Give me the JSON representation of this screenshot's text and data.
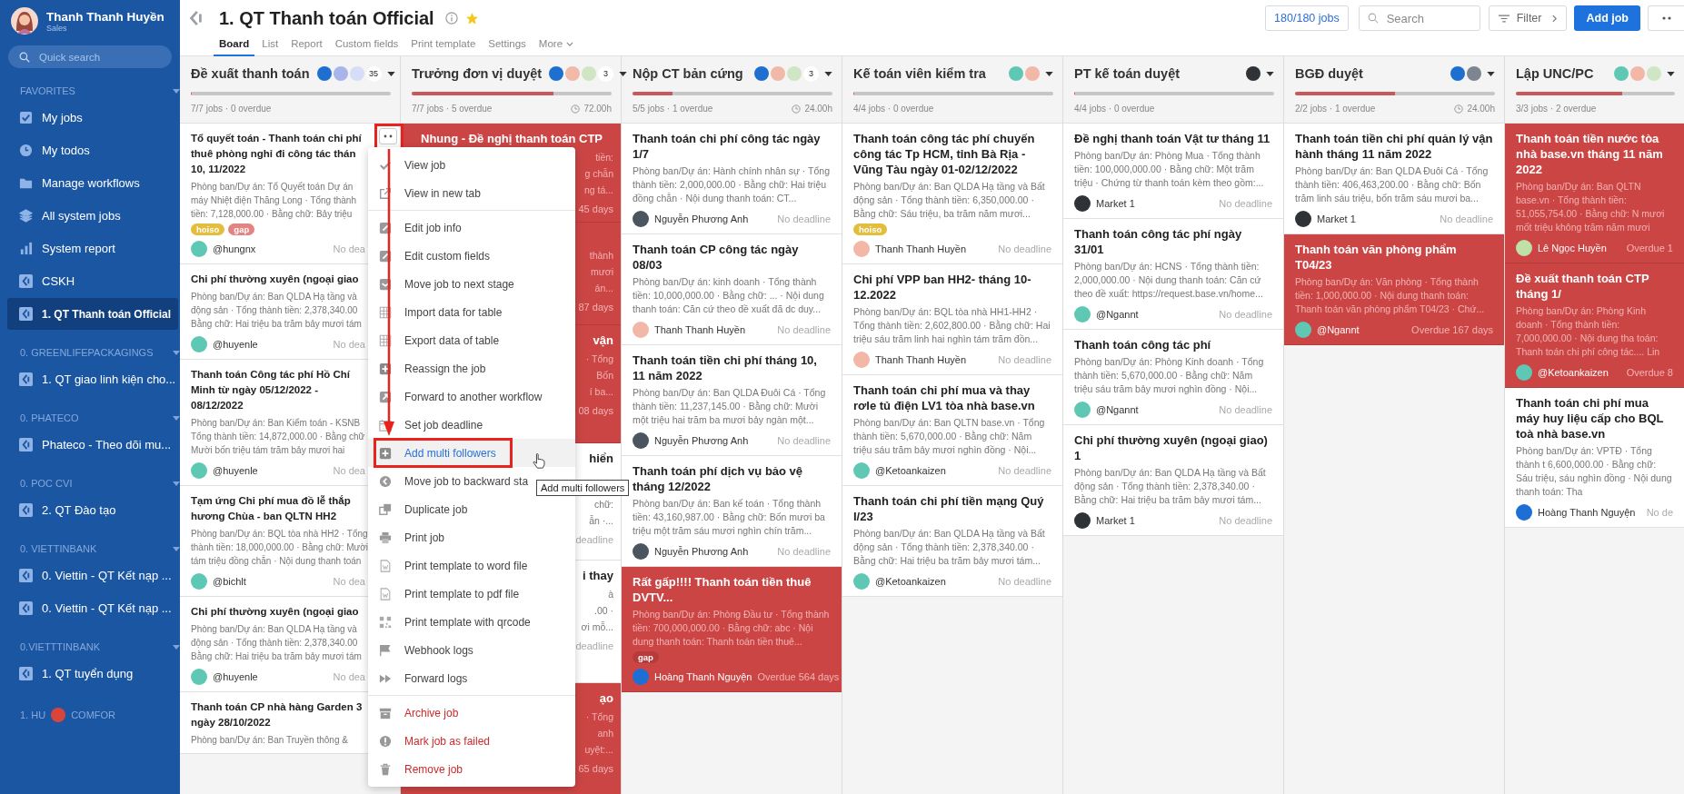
{
  "sidebar": {
    "user": {
      "name": "Thanh Thanh Huyền",
      "role": "Sales"
    },
    "search": {
      "placeholder": "Quick search"
    },
    "sections": [
      {
        "title": "FAVORITES",
        "items": [
          {
            "label": "My jobs",
            "selected": false
          },
          {
            "label": "My todos",
            "selected": false
          },
          {
            "label": "Manage workflows",
            "selected": false
          },
          {
            "label": "All system jobs",
            "selected": false
          },
          {
            "label": "System report",
            "selected": false
          },
          {
            "label": "CSKH",
            "selected": false
          },
          {
            "label": "1. QT Thanh toán Official",
            "selected": true
          }
        ]
      },
      {
        "title": "0. GREENLIFEPACKAGINGS",
        "items": [
          {
            "label": "1. QT giao linh kiện cho...",
            "selected": false
          }
        ]
      },
      {
        "title": "0. PHATECO",
        "items": [
          {
            "label": "Phateco - Theo dõi mu...",
            "selected": false
          }
        ]
      },
      {
        "title": "0. POC CVI",
        "items": [
          {
            "label": "2. QT Đào tạo",
            "selected": false
          }
        ]
      },
      {
        "title": "0. VIETTINBANK",
        "items": [
          {
            "label": "0. Viettin - QT Kết nạp ...",
            "selected": false
          },
          {
            "label": "0. Viettin - QT Kết nạp ...",
            "selected": false
          }
        ]
      },
      {
        "title": "0.VIETTTINBANK",
        "items": [
          {
            "label": "1. QT tuyển dụng",
            "selected": false
          }
        ]
      }
    ],
    "footer_texts": [
      "1. HU",
      "COMFOR"
    ]
  },
  "header": {
    "title": "1. QT Thanh toán Official",
    "favorite": true,
    "tabs": [
      {
        "label": "Board",
        "selected": true,
        "kind": "tab"
      },
      {
        "label": "List",
        "selected": false,
        "kind": "tab"
      },
      {
        "label": "Report",
        "selected": false,
        "kind": "tab"
      },
      {
        "label": "Custom fields",
        "selected": false,
        "kind": "tab"
      },
      {
        "label": "Print template",
        "selected": false,
        "kind": "tab"
      },
      {
        "label": "Settings",
        "selected": false,
        "kind": "tab"
      },
      {
        "label": "More",
        "selected": false,
        "kind": "dropdown"
      }
    ],
    "jobs_count": "180/180 jobs",
    "search": {
      "placeholder": "Search"
    },
    "filter": "Filter",
    "add_job": "Add job"
  },
  "columns": [
    {
      "name": "Đề xuất thanh toán",
      "kind": "cut_cards",
      "avatars": [
        {
          "color": "#1f6fd1"
        },
        {
          "color": "#a9b4ea"
        },
        {
          "color": "#d6def7"
        }
      ],
      "count": "35",
      "level": 0,
      "stats": "7/7 jobs · 0 overdue",
      "cards": [
        {
          "title_lines": [
            "Tổ quyết toán - Thanh toán chi phí",
            "thuê phòng nghỉ đi công tác thán",
            "10, 11/2022"
          ],
          "desc_lines": [
            "Phòng ban/Dự án: Tổ Quyết toán Dự án",
            "máy Nhiệt điện Thăng Long · Tổng thành",
            "tiền: 7,128,000.00 · Bằng chữ: Bảy triệu"
          ],
          "tags": [
            {
              "label": "hoiso",
              "color": "#e3bd3c"
            },
            {
              "label": "gap",
              "color": "#e58383"
            }
          ],
          "overdue": false,
          "user": "@hungnx",
          "avatar": {
            "color": "#5fc8b4"
          },
          "due": "No dea"
        },
        {
          "title_lines": [
            "Chi phí thường xuyên (ngoại giao"
          ],
          "desc_lines": [
            "Phòng ban/Dự án: Ban QLDA Hạ tầng và",
            "động sản · Tổng thành tiền: 2,378,340.00",
            "Bằng chữ: Hai triệu ba trăm bảy mươi tám"
          ],
          "overdue": false,
          "user": "@huyenle",
          "avatar": {
            "color": "#5fc8b4"
          },
          "due": "No dea"
        },
        {
          "title_lines": [
            "Thanh toán Công tác phí Hồ Chí",
            "Minh từ ngày 05/12/2022 -",
            "08/12/2022"
          ],
          "desc_lines": [
            "Phòng ban/Dự án: Ban Kiểm toán - KSNB",
            "Tổng thành tiền: 14,872,000.00 · Bằng chữ",
            "Mười bốn triệu tám trăm bảy mươi hai"
          ],
          "overdue": false,
          "user": "@huyenle",
          "avatar": {
            "color": "#5fc8b4"
          },
          "due": "No dea"
        },
        {
          "title_lines": [
            "Tạm ứng Chi phí mua đồ lễ thắp",
            "hương Chùa - ban QLTN HH2"
          ],
          "desc_lines": [
            "Phòng ban/Dự án: BQL tòa nhà HH2 · Tổng",
            "thành tiền: 18,000,000.00 · Bằng chữ: Mười",
            "tám triệu đồng chẵn · Nội dung thanh toán"
          ],
          "overdue": false,
          "user": "@bichlt",
          "avatar": {
            "color": "#5fc8b4"
          },
          "due": "No dea"
        },
        {
          "title_lines": [
            "Chi phí thường xuyên (ngoại giao"
          ],
          "desc_lines": [
            "Phòng ban/Dự án: Ban QLDA Hạ tầng và",
            "động sản · Tổng thành tiền: 2,378,340.00",
            "Bằng chữ: Hai triệu ba trăm bảy mươi tám"
          ],
          "overdue": false,
          "user": "@huyenle",
          "avatar": {
            "color": "#5fc8b4"
          },
          "due": "No dea"
        },
        {
          "title_lines": [
            "Thanh toán CP nhà hàng Garden 3",
            "ngày 28/10/2022"
          ],
          "desc_lines": [
            "Phòng ban/Dự án: Ban Truyền thông &"
          ],
          "overdue": false
        }
      ]
    },
    {
      "name": "Trưởng đơn vị duyệt",
      "kind": "fragments",
      "avatars": [
        {
          "color": "#1f6fd1"
        },
        {
          "color": "#f0b9a8"
        },
        {
          "color": "#cfe5c4"
        }
      ],
      "count": "3",
      "level": 0.71,
      "stats": "7/7 jobs · 5 overdue",
      "time": "72.00h",
      "cards": [
        {
          "title": "Nhung - Đề nghị thanh toán CTP",
          "lines": [
            "tiền:",
            "g chẫn",
            "ng tá..."
          ],
          "due": "45 days",
          "overdue": true
        },
        {
          "lines": [
            "thành",
            "mươi",
            "án..."
          ],
          "due": "87 days",
          "overdue": true
        },
        {
          "title_fragment": "vận",
          "lines": [
            "· Tổng",
            "Bốn",
            "í ba..."
          ],
          "due": "08 days",
          "overdue": true
        },
        {
          "title_fragment": "hiển",
          "lines": [
            "chữ:",
            "ẫn ·..."
          ],
          "due": "deadline",
          "overdue": false
        },
        {
          "title_fragment": "i thay",
          "lines": [
            "à",
            ".00 ·",
            "ơi mỗ..."
          ],
          "due": "deadline",
          "overdue": false
        },
        {
          "title_fragment": "ạo",
          "lines": [
            "· Tổng",
            "anh",
            "uyệt:..."
          ],
          "due": "65 days",
          "overdue": true
        }
      ]
    },
    {
      "name": "Nộp CT bản cứng",
      "kind": "cards",
      "avatars": [
        {
          "color": "#1f6fd1"
        },
        {
          "color": "#f0b9a8"
        },
        {
          "color": "#cfe5c4"
        }
      ],
      "count": "3",
      "level": 0.2,
      "stats": "5/5 jobs · 1 overdue",
      "time": "24.00h",
      "cards": [
        {
          "title": "Thanh toán chi phí công tác ngày 1/7",
          "desc": "Phòng ban/Dự án: Hành chính nhân sự · Tổng thành tiền: 2,000,000.00 · Bằng chữ: Hai triệu đồng chẵn · Nội dung thanh toán: CT...",
          "overdue": false,
          "user": "Nguyễn Phương Anh",
          "avatar": {
            "color": "#4a5560"
          },
          "due": "No deadline"
        },
        {
          "title": "Thanh toán CP công tác ngày 08/03",
          "desc": "Phòng ban/Dự án: kinh doanh · Tổng thành tiền: 10,000,000.00 · Bằng chữ: ... · Nội dung thanh toán: Căn cứ theo đề xuất đã dc duy...",
          "overdue": false,
          "user": "Thanh Thanh Huyền",
          "avatar": {
            "color": "#f2b7a6"
          },
          "due": "No deadline"
        },
        {
          "title": "Thanh toán tiền chi phí tháng 10, 11 năm 2022",
          "desc": "Phòng ban/Dự án: Ban QLDA Đuôi Cá · Tổng thành tiền: 11,237,145.00 · Bằng chữ: Mười một triệu hai trăm ba mươi bảy ngàn một...",
          "overdue": false,
          "user": "Nguyễn Phương Anh",
          "avatar": {
            "color": "#4a5560"
          },
          "due": "No deadline"
        },
        {
          "title": "Thanh toán phí dịch vụ bảo vệ tháng 12/2022",
          "desc": "Phòng ban/Dự án: Ban kế toán · Tổng thành tiền: 43,160,987.00 · Bằng chữ: Bốn mươi ba triệu một trăm sáu mươi nghìn chín trăm...",
          "overdue": false,
          "user": "Nguyễn Phương Anh",
          "avatar": {
            "color": "#4a5560"
          },
          "due": "No deadline"
        },
        {
          "title": "Rất gấp!!!! Thanh toán tiền thuê DVTV...",
          "desc": "Phòng ban/Dự án: Phòng Đầu tư · Tổng thành tiền: 700,000,000.00 · Bằng chữ: abc · Nội dung thanh toán: Thanh toán tiền thuê...",
          "tags": [
            {
              "label": "gap",
              "color": "#b83a3a"
            }
          ],
          "overdue": true,
          "user": "Hoàng Thanh Nguyện",
          "avatar": {
            "color": "#1d6fd6"
          },
          "due": "Overdue 564 days"
        }
      ]
    },
    {
      "name": "Kế toán viên kiểm tra",
      "kind": "cards",
      "avatars": [
        {
          "color": "#5fc8b4"
        },
        {
          "color": "#f2b7a6"
        }
      ],
      "level": 0,
      "stats": "4/4 jobs · 0 overdue",
      "cards": [
        {
          "title": "Thanh toán công tác phí chuyến công tác Tp HCM, tỉnh Bà Rịa - Vũng Tàu ngày 01-02/12/2022",
          "desc": "Phòng ban/Dự án: Ban QLDA Hạ tầng và Bất động sản · Tổng thành tiền: 6,350,000.00 · Bằng chữ: Sáu triệu, ba trăm năm mươi...",
          "tags": [
            {
              "label": "hoiso",
              "color": "#e3bd3c"
            }
          ],
          "overdue": false,
          "user": "Thanh Thanh Huyền",
          "avatar": {
            "color": "#f2b7a6"
          },
          "due": "No deadline"
        },
        {
          "title": "Chi phí VPP ban HH2- tháng 10-12.2022",
          "desc": "Phòng ban/Dự án: BQL tòa nhà HH1-HH2 · Tổng thành tiền: 2,602,800.00 · Bằng chữ: Hai triệu sáu trăm linh hai nghìn tám trăm đồn...",
          "overdue": false,
          "user": "Thanh Thanh Huyền",
          "avatar": {
            "color": "#f2b7a6"
          },
          "due": "No deadline"
        },
        {
          "title": "Thanh toán chi phí mua và thay rơle tủ điện LV1 tòa nhà base.vn",
          "desc": "Phòng ban/Dự án: Ban QLTN base.vn · Tổng thành tiền: 5,670,000.00 · Bằng chữ: Năm triệu sáu trăm bảy mươi nghìn đồng · Nội...",
          "overdue": false,
          "user": "@Ketoankaizen",
          "avatar": {
            "color": "#5fc8b4"
          },
          "due": "No deadline"
        },
        {
          "title": "Thanh toán chi phí tiền mạng Quý I/23",
          "desc": "Phòng ban/Dự án: Ban QLDA Hạ tầng và Bất động sản · Tổng thành tiền: 2,378,340.00 · Bằng chữ: Hai triệu ba trăm bảy mươi tám...",
          "overdue": false,
          "user": "@Ketoankaizen",
          "avatar": {
            "color": "#5fc8b4"
          },
          "due": "No deadline"
        }
      ]
    },
    {
      "name": "PT kế toán duyệt",
      "kind": "cards",
      "avatars": [
        {
          "color": "#2f3338"
        }
      ],
      "level": 0,
      "stats": "4/4 jobs · 0 overdue",
      "cards": [
        {
          "title": "Đề nghị thanh toán Vật tư tháng 11",
          "desc": "Phòng ban/Dự án: Phòng Mua · Tổng thành tiền: 100,000,000.00 · Bằng chữ: Một trăm triệu · Chứng từ thanh toán kèm theo gồm:...",
          "overdue": false,
          "user": "Market 1",
          "avatar": {
            "color": "#2f3338"
          },
          "due": "No deadline"
        },
        {
          "title": "Thanh toán công tác phí ngày 31/01",
          "desc": "Phòng ban/Dự án: HCNS · Tổng thành tiền: 2,000,000.00 · Nội dung thanh toán: Căn cứ theo đề xuất: https://request.base.vn/home...",
          "overdue": false,
          "user": "@Ngannt",
          "avatar": {
            "color": "#5fc8b4"
          },
          "due": "No deadline"
        },
        {
          "title": "Thanh toán công tác phí",
          "desc": "Phòng ban/Dự án: Phòng Kinh doanh · Tổng thành tiền: 5,670,000.00 · Bằng chữ: Năm triệu sáu trăm bảy mươi nghìn đồng · Nội...",
          "overdue": false,
          "user": "@Ngannt",
          "avatar": {
            "color": "#5fc8b4"
          },
          "due": "No deadline"
        },
        {
          "title": "Chi phí thường xuyên (ngoại giao) 1",
          "desc": "Phòng ban/Dự án: Ban QLDA Hạ tầng và Bất động sản · Tổng thành tiền: 2,378,340.00 · Bằng chữ: Hai triệu ba trăm bảy mươi tám...",
          "overdue": false,
          "user": "Market 1",
          "avatar": {
            "color": "#2f3338"
          },
          "due": "No deadline"
        }
      ]
    },
    {
      "name": "BGĐ duyệt",
      "kind": "cards",
      "avatars": [
        {
          "color": "#1f6fd1"
        },
        {
          "color": "#7d8590"
        }
      ],
      "level": 0.5,
      "stats": "2/2 jobs · 1 overdue",
      "time": "24.00h",
      "cards": [
        {
          "title": "Thanh toán tiền chi phí quản lý vận hành tháng 11 năm 2022",
          "desc": "Phòng ban/Dự án: Ban QLDA Đuôi Cá · Tổng thành tiền: 406,463,200.00 · Bằng chữ: Bốn trăm linh sáu triệu, bốn trăm sáu mươi ba...",
          "overdue": false,
          "user": "Market 1",
          "avatar": {
            "color": "#2f3338"
          },
          "due": "No deadline"
        },
        {
          "title": "Thanh toán văn phòng phẩm T04/23",
          "desc": "Phòng ban/Dự án: Văn phòng · Tổng thành tiền: 1,000,000.00 · Nội dung thanh toán: Thanh toán văn phòng phẩm T04/23 · Chứ...",
          "overdue": true,
          "user": "@Ngannt",
          "avatar": {
            "color": "#5fc8b4"
          },
          "due": "Overdue 167 days"
        }
      ]
    },
    {
      "name": "Lập UNC/PC",
      "kind": "cards",
      "avatars": [
        {
          "color": "#5fc8b4"
        },
        {
          "color": "#f2b7a6"
        },
        {
          "color": "#cfe5c4"
        }
      ],
      "level": 0.67,
      "stats": "3/3 jobs · 2 overdue",
      "cards": [
        {
          "title": "Thanh toán tiền nước tòa nhà base.vn tháng 11 năm 2022",
          "desc": "Phòng ban/Dự án: Ban QLTN base.vn · Tổng thành tiền: 51,055,754.00 · Bằng chữ: N mươi mốt triệu không trăm năm mươi",
          "overdue": true,
          "user": "Lê Ngọc Huyền",
          "avatar": {
            "color": "#bfe0a8"
          },
          "due": "Overdue 1"
        },
        {
          "title": "Đề xuất thanh toán CTP tháng 1/",
          "desc": "Phòng ban/Dự án: Phòng Kinh doanh · Tổng thành tiền: 7,000,000.00 · Nội dung tha toán: Thanh toán chi phí công tác.... Lin",
          "overdue": true,
          "user": "@Ketoankaizen",
          "avatar": {
            "color": "#5fc8b4"
          },
          "due": "Overdue 8"
        },
        {
          "title": "Thanh toán chi phí mua máy huy liệu cấp cho BQL toà nhà base.vn",
          "desc": "Phòng ban/Dự án: VPTĐ · Tổng thành t 6,600,000.00 · Bằng chữ: Sáu triệu, sáu nghìn đồng · Nội dung thanh toán: Tha",
          "overdue": false,
          "user": "Hoàng Thanh Nguyện",
          "avatar": {
            "color": "#1d6fd6"
          },
          "due": "No de"
        }
      ]
    }
  ],
  "context_menu": {
    "groups": [
      [
        {
          "label": "View job",
          "kind": "normal",
          "selected": false
        },
        {
          "label": "View in new tab",
          "kind": "normal",
          "selected": false
        }
      ],
      [
        {
          "label": "Edit job info",
          "kind": "normal",
          "selected": false
        },
        {
          "label": "Edit custom fields",
          "kind": "normal",
          "selected": false
        },
        {
          "label": "Move job to next stage",
          "kind": "normal",
          "selected": false
        },
        {
          "label": "Import data for table",
          "kind": "normal",
          "selected": false
        },
        {
          "label": "Export data of table",
          "kind": "normal",
          "selected": false
        },
        {
          "label": "Reassign the job",
          "kind": "normal",
          "selected": false
        },
        {
          "label": "Forward to another workflow",
          "kind": "normal",
          "selected": false
        },
        {
          "label": "Set job deadline",
          "kind": "normal",
          "selected": false
        },
        {
          "label": "Add multi followers",
          "kind": "normal",
          "selected": true
        },
        {
          "label": "Move job to backward sta",
          "kind": "normal",
          "selected": false
        },
        {
          "label": "Duplicate job",
          "kind": "normal",
          "selected": false
        },
        {
          "label": "Print job",
          "kind": "normal",
          "selected": false
        },
        {
          "label": "Print template to word file",
          "kind": "normal",
          "selected": false
        },
        {
          "label": "Print template to pdf file",
          "kind": "normal",
          "selected": false
        },
        {
          "label": "Print template with qrcode",
          "kind": "normal",
          "selected": false
        },
        {
          "label": "Webhook logs",
          "kind": "normal",
          "selected": false
        },
        {
          "label": "Forward logs",
          "kind": "normal",
          "selected": false
        }
      ],
      [
        {
          "label": "Archive job",
          "kind": "danger",
          "selected": false
        },
        {
          "label": "Mark job as failed",
          "kind": "danger",
          "selected": false
        },
        {
          "label": "Remove job",
          "kind": "danger",
          "selected": false
        }
      ]
    ]
  },
  "tooltip": "Add multi followers"
}
